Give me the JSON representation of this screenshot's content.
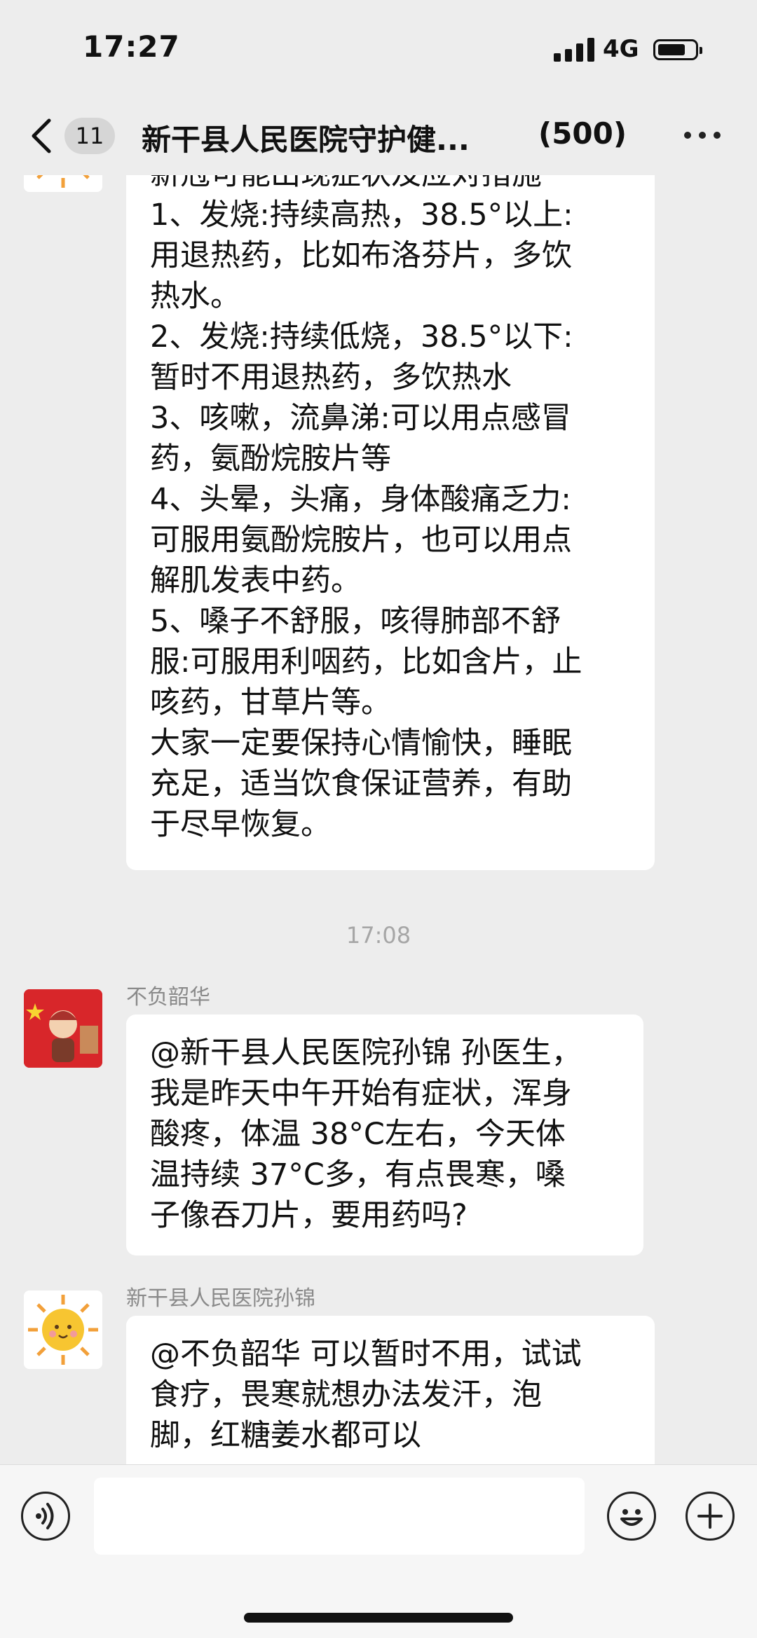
{
  "status_bar": {
    "time": "17:27",
    "network": "4G"
  },
  "nav": {
    "unread_badge": "11",
    "title": "新干县人民医院守护健...",
    "member_count": "(500)"
  },
  "messages": {
    "first": {
      "lines": [
        "新冠可能出现症状及应对措施",
        "1、发烧:持续高热，38.5°以上:",
        "用退热药，比如布洛芬片，多饮",
        "热水。",
        "2、发烧:持续低烧，38.5°以下:",
        "暂时不用退热药，多饮热水",
        "3、咳嗽，流鼻涕:可以用点感冒",
        "药，氨酚烷胺片等",
        "4、头晕，头痛，身体酸痛乏力:",
        "可服用氨酚烷胺片，也可以用点",
        "解肌发表中药。",
        "5、嗓子不舒服，咳得肺部不舒",
        "服:可服用利咽药，比如含片，止",
        "咳药，甘草片等。",
        "大家一定要保持心情愉快，睡眠",
        "充足，适当饮食保证营养，有助",
        "于尽早恢复。"
      ]
    },
    "timestamp": "17:08",
    "second": {
      "sender": "不负韶华",
      "lines": [
        "@新干县人民医院孙锦 孙医生，",
        "我是昨天中午开始有症状，浑身",
        "酸疼，体温 38°C左右，今天体",
        "温持续 37°C多，有点畏寒，嗓",
        "子像吞刀片，要用药吗?"
      ]
    },
    "third": {
      "sender": "新干县人民医院孙锦",
      "lines": [
        "@不负韶华 可以暂时不用，试试",
        "食疗，畏寒就想办法发汗，泡",
        "脚，红糖姜水都可以"
      ]
    }
  },
  "icons": {
    "back": "chevron-left-icon",
    "more": "more-dots-icon",
    "voice": "voice-icon",
    "emoji": "emoji-icon",
    "add": "plus-icon"
  },
  "colors": {
    "background": "#ededed",
    "bubble": "#ffffff",
    "meta_text": "#8a8a8a"
  }
}
